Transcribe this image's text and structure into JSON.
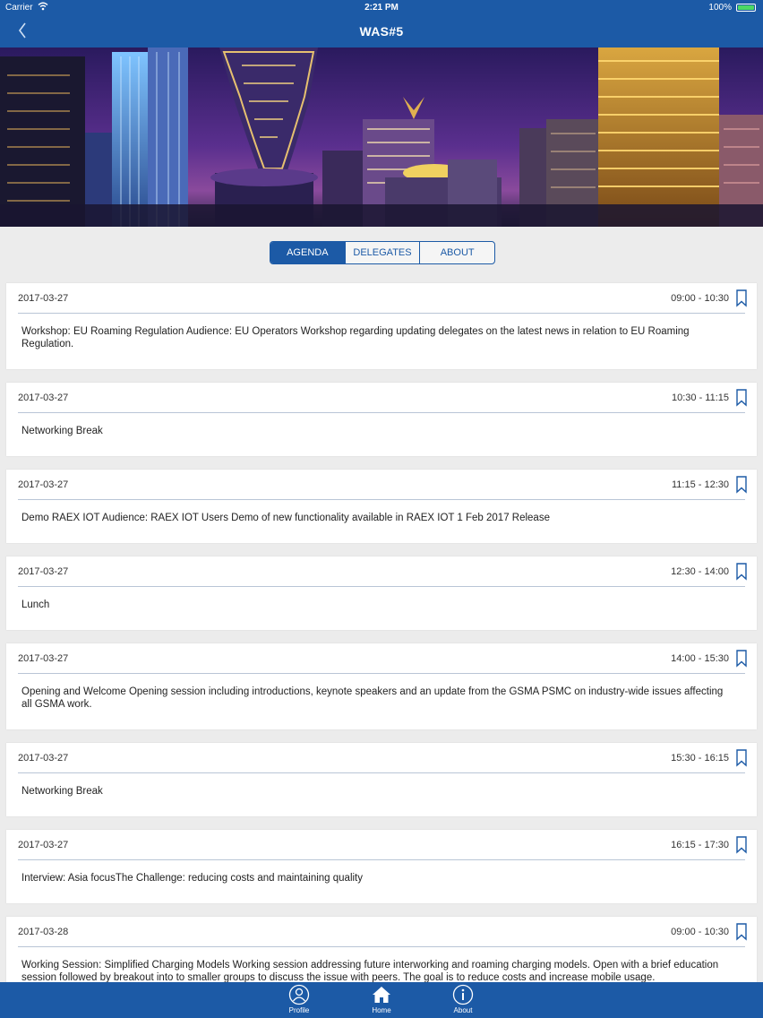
{
  "status_bar": {
    "carrier": "Carrier",
    "time": "2:21 PM",
    "battery": "100%"
  },
  "nav": {
    "title": "WAS#5"
  },
  "segments": [
    {
      "label": "AGENDA",
      "active": true
    },
    {
      "label": "DELEGATES",
      "active": false
    },
    {
      "label": "ABOUT",
      "active": false
    }
  ],
  "agenda": [
    {
      "date": "2017-03-27",
      "time": "09:00 - 10:30",
      "title": "Workshop: EU Roaming Regulation Audience: EU Operators Workshop regarding updating delegates on the latest news in relation to EU Roaming Regulation."
    },
    {
      "date": "2017-03-27",
      "time": "10:30 - 11:15",
      "title": "Networking Break"
    },
    {
      "date": "2017-03-27",
      "time": "11:15 - 12:30",
      "title": "Demo RAEX IOT Audience: RAEX IOT Users Demo of new functionality available in RAEX IOT 1 Feb 2017 Release"
    },
    {
      "date": "2017-03-27",
      "time": "12:30 - 14:00",
      "title": "Lunch"
    },
    {
      "date": "2017-03-27",
      "time": "14:00 - 15:30",
      "title": "Opening and Welcome Opening session including introductions, keynote speakers and an update from the GSMA PSMC on industry-wide issues affecting all GSMA work."
    },
    {
      "date": "2017-03-27",
      "time": "15:30 - 16:15",
      "title": "Networking Break"
    },
    {
      "date": "2017-03-27",
      "time": "16:15 - 17:30",
      "title": "Interview: Asia focusThe Challenge: reducing costs and maintaining quality"
    },
    {
      "date": "2017-03-28",
      "time": "09:00 - 10:30",
      "title": "Working Session: Simplified Charging Models Working session addressing future interworking and roaming charging models. Open with a brief education session followed by breakout into to smaller groups to discuss the issue with peers. The goal is to reduce costs and increase mobile usage."
    }
  ],
  "tabbar": [
    {
      "label": "Profile",
      "icon": "profile-icon"
    },
    {
      "label": "Home",
      "icon": "home-icon"
    },
    {
      "label": "About",
      "icon": "info-icon"
    }
  ],
  "colors": {
    "brand": "#1c5aa6",
    "background": "#ececec",
    "card": "#ffffff",
    "battery": "#4cd964"
  }
}
